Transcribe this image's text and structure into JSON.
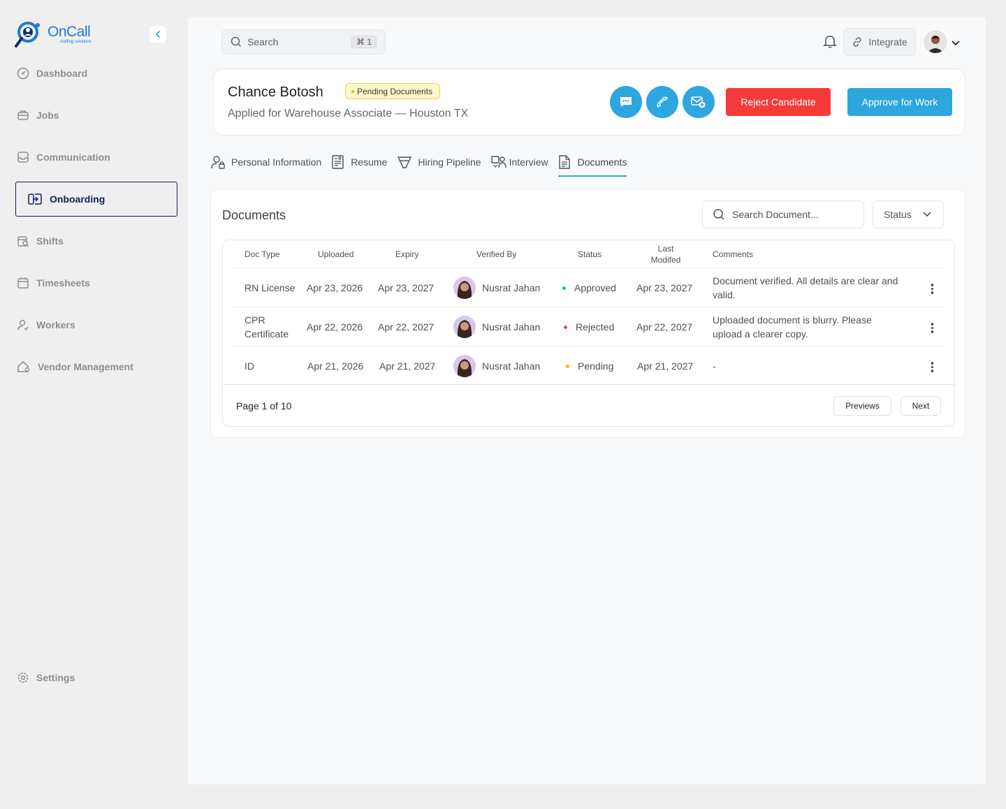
{
  "brand": {
    "name": "OnCall",
    "tagline": "staffing solutions",
    "color": "#1f7ad6"
  },
  "sidebar": {
    "items": [
      {
        "label": "Dashboard",
        "icon": "dashboard-icon"
      },
      {
        "label": "Jobs",
        "icon": "briefcase-icon"
      },
      {
        "label": "Communication",
        "icon": "inbox-icon"
      },
      {
        "label": "Onboarding",
        "icon": "onboarding-icon",
        "active": true
      },
      {
        "label": "Shifts",
        "icon": "shifts-icon"
      },
      {
        "label": "Timesheets",
        "icon": "calendar-icon"
      },
      {
        "label": "Workers",
        "icon": "worker-icon"
      },
      {
        "label": "Vendor Management",
        "icon": "vendor-icon"
      }
    ],
    "settings_label": "Settings"
  },
  "topbar": {
    "search_placeholder": "Search",
    "shortcut": "⌘ 1",
    "integrate_label": "Integrate"
  },
  "candidate": {
    "name": "Chance Botosh",
    "status_badge": "Pending Documents",
    "subtitle": "Applied for Warehouse Associate — Houston TX",
    "reject_label": "Reject Candidate",
    "approve_label": "Approve for Work"
  },
  "tabs": [
    "Personal Information",
    "Resume",
    "Hiring Pipeline",
    "Interview",
    "Documents"
  ],
  "active_tab": "Documents",
  "documents": {
    "title": "Documents",
    "search_placeholder": "Search Document...",
    "status_filter": "Status",
    "columns": {
      "doc_type": "Doc Type",
      "uploaded": "Uploaded",
      "expiry": "Expiry",
      "verified_by": "Verified By",
      "status": "Status",
      "last_modified": "Last Modifed",
      "comments": "Comments"
    },
    "rows": [
      {
        "doc_type": "RN License",
        "uploaded": "Apr 23, 2026",
        "expiry": "Apr 23, 2027",
        "verified_by": "Nusrat Jahan",
        "status": "Approved",
        "status_color": "#22c55e",
        "last_modified": "Apr 23, 2027",
        "comments": "Document verified. All details are clear and valid."
      },
      {
        "doc_type": "CPR Certificate",
        "uploaded": "Apr 22, 2026",
        "expiry": "Apr 22, 2027",
        "verified_by": "Nusrat Jahan",
        "status": "Rejected",
        "status_color": "#ef4444",
        "last_modified": "Apr 22, 2027",
        "comments": "Uploaded document is blurry. Please upload a clearer copy."
      },
      {
        "doc_type": "ID",
        "uploaded": "Apr 21, 2026",
        "expiry": "Apr 21, 2027",
        "verified_by": "Nusrat Jahan",
        "status": "Pending",
        "status_color": "#f5b800",
        "last_modified": "Apr 21, 2027",
        "comments": "-"
      }
    ],
    "pagination": {
      "info": "Page 1 of 10",
      "prev_label": "Previews",
      "next_label": "Next"
    }
  },
  "colors": {
    "accent": "#2ea6e0",
    "danger": "#f53a3a",
    "nav_active": "#0f1f5c",
    "badge_bg": "#fff7cc"
  }
}
